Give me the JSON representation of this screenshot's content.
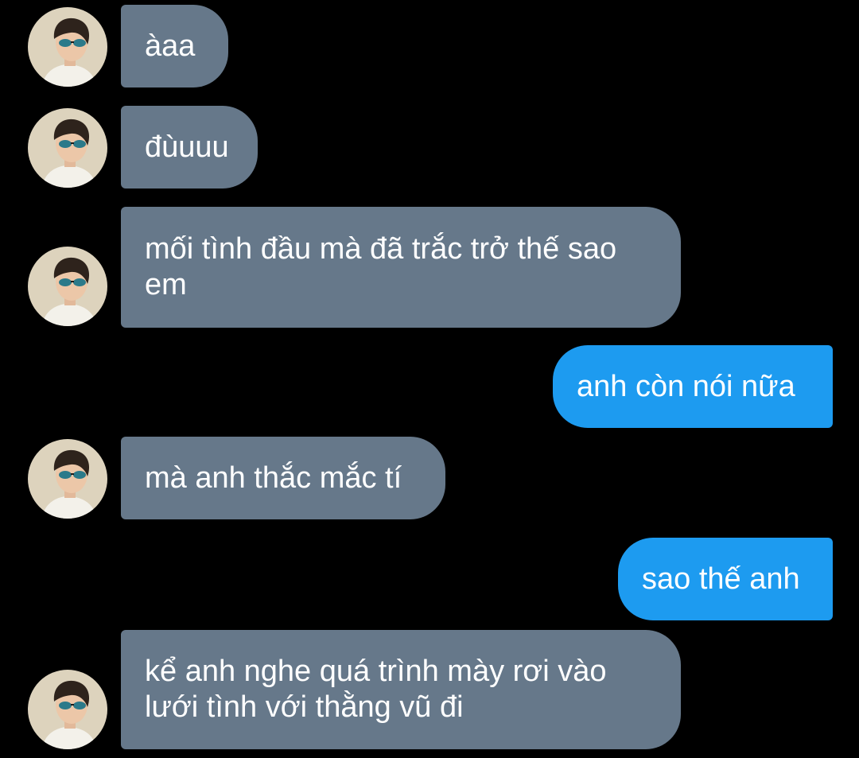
{
  "colors": {
    "background": "#000000",
    "incoming_bubble": "#66788a",
    "outgoing_bubble": "#1d9bf0",
    "text": "#ffffff"
  },
  "messages": [
    {
      "sender": "other",
      "text": "àaa",
      "avatar": "user-avatar"
    },
    {
      "sender": "other",
      "text": "đùuuu",
      "avatar": "user-avatar"
    },
    {
      "sender": "other",
      "text": "mối tình đầu mà đã trắc trở thế sao\nem",
      "avatar": "user-avatar"
    },
    {
      "sender": "self",
      "text": "anh còn nói nữa"
    },
    {
      "sender": "other",
      "text": "mà anh thắc mắc tí",
      "avatar": "user-avatar"
    },
    {
      "sender": "self",
      "text": "sao thế anh"
    },
    {
      "sender": "other",
      "text": "kể anh nghe quá trình mày rơi vào\nlưới tình với thằng vũ đi",
      "avatar": "user-avatar"
    }
  ]
}
